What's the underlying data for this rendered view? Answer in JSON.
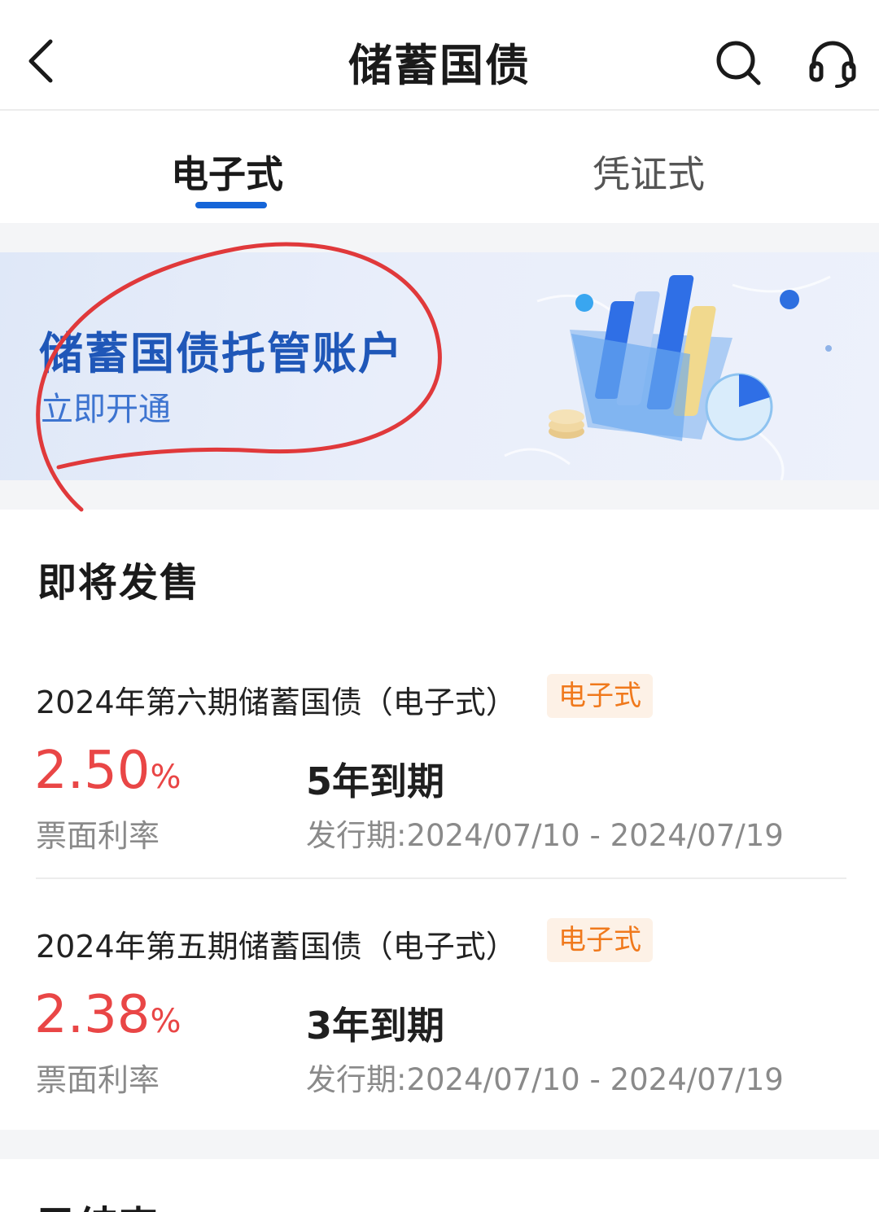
{
  "header": {
    "title": "储蓄国债",
    "back_icon": "chevron-left-icon",
    "search_icon": "search-icon",
    "service_icon": "headset-icon"
  },
  "tabs": [
    {
      "label": "电子式",
      "active": true
    },
    {
      "label": "凭证式",
      "active": false
    }
  ],
  "banner": {
    "title": "储蓄国债托管账户",
    "subtitle": "立即开通"
  },
  "upcoming": {
    "title": "即将发售",
    "bonds": [
      {
        "name": "2024年第六期储蓄国债（电子式）",
        "tag": "电子式",
        "rate": "2.50",
        "rate_unit": "%",
        "rate_label": "票面利率",
        "term": "5年到期",
        "period": "发行期:2024/07/10 - 2024/07/19"
      },
      {
        "name": "2024年第五期储蓄国债（电子式）",
        "tag": "电子式",
        "rate": "2.38",
        "rate_unit": "%",
        "rate_label": "票面利率",
        "term": "3年到期",
        "period": "发行期:2024/07/10 - 2024/07/19"
      }
    ]
  },
  "next_section": {
    "title": "已结束"
  },
  "colors": {
    "accent": "#1565d8",
    "rate": "#e94646",
    "tag_text": "#f0791c",
    "tag_bg": "#fdf1e6",
    "annotation": "#e0393b"
  }
}
